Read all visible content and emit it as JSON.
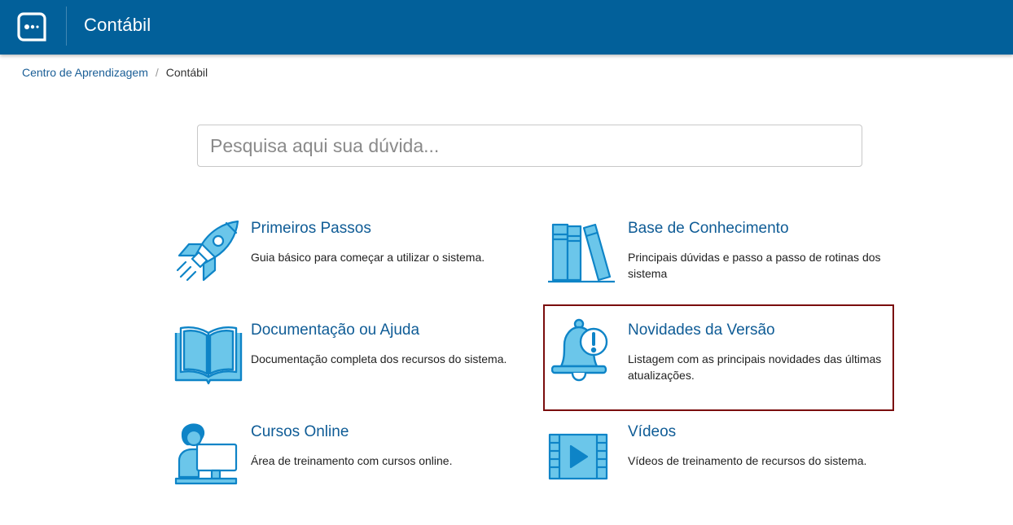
{
  "header": {
    "app_title": "Contábil",
    "logo_icon": "chat-bubble-logo-icon",
    "background_color": "#02609a"
  },
  "breadcrumb": {
    "root": "Centro de Aprendizagem",
    "separator": "/",
    "current": "Contábil"
  },
  "search": {
    "placeholder": "Pesquisa aqui sua dúvida...",
    "value": ""
  },
  "cards": [
    {
      "id": "primeiros-passos",
      "icon": "rocket-icon",
      "title": "Primeiros Passos",
      "description": "Guia básico para começar a utilizar o sistema.",
      "selected": false
    },
    {
      "id": "base-conhecimento",
      "icon": "books-icon",
      "title": "Base de Conhecimento",
      "description": "Principais dúvidas e passo a passo de rotinas dos sistema",
      "selected": false
    },
    {
      "id": "documentacao",
      "icon": "open-book-icon",
      "title": "Documentação ou Ajuda",
      "description": "Documentação completa dos recursos do sistema.",
      "selected": false
    },
    {
      "id": "novidades",
      "icon": "bell-alert-icon",
      "title": "Novidades da Versão",
      "description": "Listagem com as principais novidades das últimas atualizações.",
      "selected": true
    },
    {
      "id": "cursos-online",
      "icon": "student-computer-icon",
      "title": "Cursos Online",
      "description": "Área de treinamento com cursos online.",
      "selected": false
    },
    {
      "id": "videos",
      "icon": "video-film-icon",
      "title": "Vídeos",
      "description": "Vídeos de treinamento de recursos do sistema.",
      "selected": false
    }
  ],
  "colors": {
    "icon_fill": "#6bc6ea",
    "icon_stroke": "#0e84c7",
    "link_blue": "#0f5c96",
    "selection_border": "#7a0d0d"
  }
}
